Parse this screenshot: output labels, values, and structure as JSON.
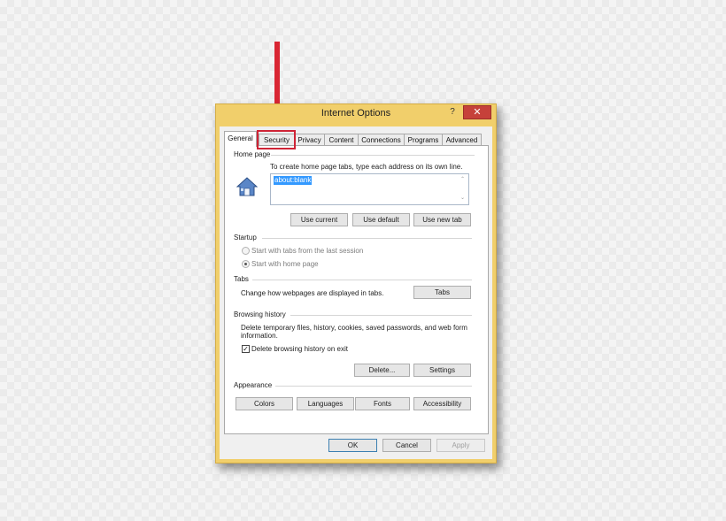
{
  "window": {
    "title": "Internet Options",
    "help": "?",
    "close": "✕"
  },
  "tabs": [
    "General",
    "Security",
    "Privacy",
    "Content",
    "Connections",
    "Programs",
    "Advanced"
  ],
  "home_page": {
    "group": "Home page",
    "instruction": "To create home page tabs, type each address on its own line.",
    "url": "about:blank",
    "buttons": {
      "use_current": "Use current",
      "use_default": "Use default",
      "use_new_tab": "Use new tab"
    }
  },
  "startup": {
    "group": "Startup",
    "option_last_session": "Start with tabs from the last session",
    "option_home_page": "Start with home page"
  },
  "tabs_section": {
    "group": "Tabs",
    "text": "Change how webpages are displayed in tabs.",
    "button": "Tabs"
  },
  "history": {
    "group": "Browsing history",
    "text": "Delete temporary files, history, cookies, saved passwords, and web form information.",
    "checkbox": "Delete browsing history on exit",
    "delete": "Delete...",
    "settings": "Settings"
  },
  "appearance": {
    "group": "Appearance",
    "colors": "Colors",
    "languages": "Languages",
    "fonts": "Fonts",
    "accessibility": "Accessibility"
  },
  "footer": {
    "ok": "OK",
    "cancel": "Cancel",
    "apply": "Apply"
  },
  "colors": {
    "arrow": "#d92633",
    "title_bar": "#f1cf6b",
    "close": "#c6413a"
  }
}
